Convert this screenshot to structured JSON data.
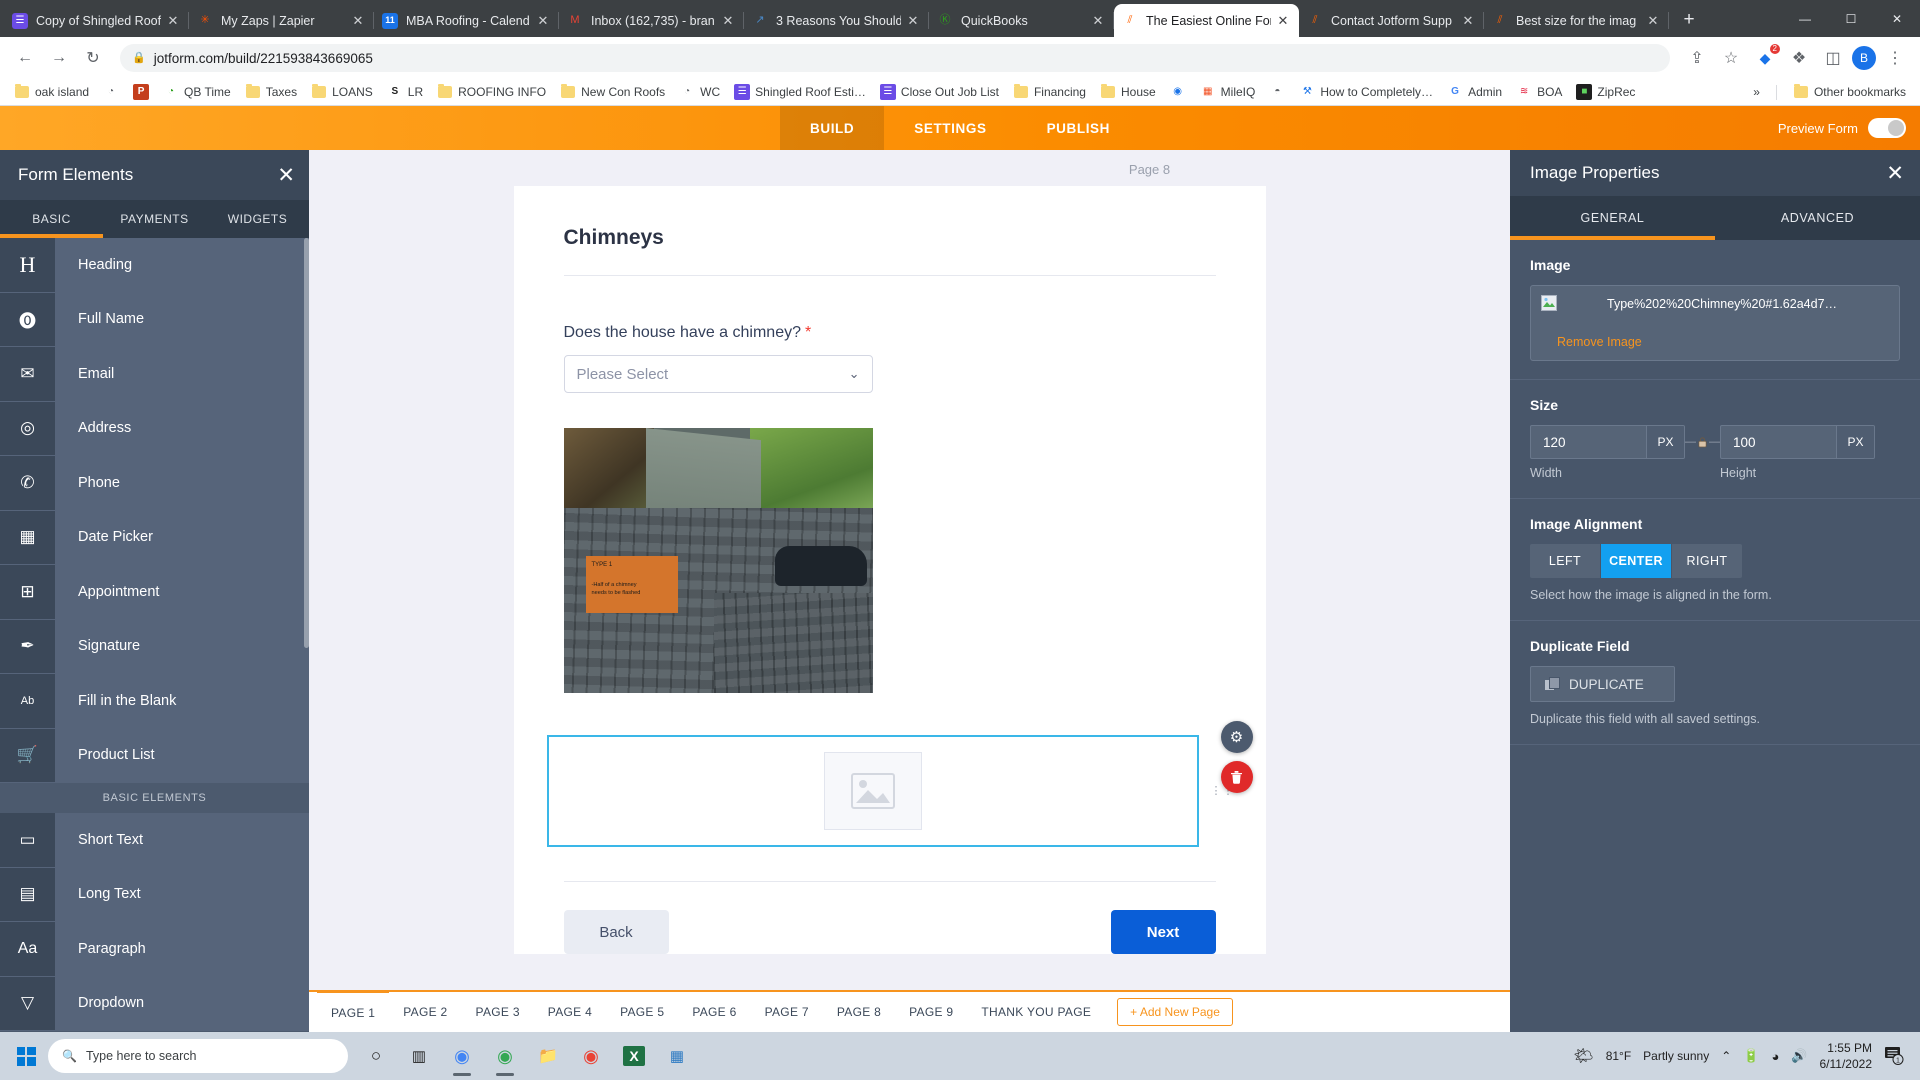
{
  "browser": {
    "tabs": [
      {
        "title": "Copy of Shingled Roof",
        "favicon": "list-icon",
        "fav_color": "#6b4ce6",
        "fav_glyph": "☰",
        "active": false
      },
      {
        "title": "My Zaps | Zapier",
        "favicon": "zapier-icon",
        "fav_color": "#ff4f00",
        "fav_glyph": "✳",
        "active": false
      },
      {
        "title": "MBA Roofing - Calend",
        "favicon": "google-calendar-icon",
        "fav_color": "#1a73e8",
        "fav_glyph": "11",
        "active": false
      },
      {
        "title": "Inbox (162,735) - bran",
        "favicon": "gmail-icon",
        "fav_color": "#ea4335",
        "fav_glyph": "M",
        "active": false
      },
      {
        "title": "3 Reasons You Should",
        "favicon": "chart-icon",
        "fav_color": "#4a88c7",
        "fav_glyph": "↗",
        "active": false
      },
      {
        "title": "QuickBooks",
        "favicon": "quickbooks-icon",
        "fav_color": "#2ca01c",
        "fav_glyph": "Ⓚ",
        "active": false
      },
      {
        "title": "The Easiest Online For",
        "favicon": "jotform-icon",
        "fav_color": "#ff6100",
        "fav_glyph": "⫽",
        "active": true
      },
      {
        "title": "Contact Jotform Supp",
        "favicon": "jotform-icon",
        "fav_color": "#ff6100",
        "fav_glyph": "⫽",
        "active": false
      },
      {
        "title": "Best size for the imag",
        "favicon": "jotform-icon",
        "fav_color": "#ff6100",
        "fav_glyph": "⫽",
        "active": false
      }
    ],
    "tab_close_label": "✕",
    "new_tab_label": "+",
    "window_controls": {
      "minimize": "—",
      "maximize": "☐",
      "close": "✕"
    },
    "nav": {
      "back": "←",
      "forward": "→",
      "reload": "↻"
    },
    "omnibox": {
      "lock": "🔒",
      "url": "jotform.com/build/221593843669065"
    },
    "toolbar_icons": {
      "share": "⇪",
      "bookmark_star": "☆",
      "extension_count": "2",
      "puzzle": "❖",
      "sidepanel": "◫",
      "profile_initial": "B",
      "menu": "⋮"
    },
    "bookmarks": [
      {
        "label": "oak island",
        "icon": "folder-icon"
      },
      {
        "label": "",
        "icon": "globe-icon"
      },
      {
        "label": "",
        "icon": "powerpoint-icon"
      },
      {
        "label": "QB Time",
        "icon": "qbtime-icon"
      },
      {
        "label": "Taxes",
        "icon": "folder-icon"
      },
      {
        "label": "LOANS",
        "icon": "folder-icon"
      },
      {
        "label": "LR",
        "icon": "stripe-icon"
      },
      {
        "label": "ROOFING INFO",
        "icon": "folder-icon"
      },
      {
        "label": "New Con Roofs",
        "icon": "folder-icon"
      },
      {
        "label": "WC",
        "icon": "globe-icon"
      },
      {
        "label": "Shingled Roof Esti…",
        "icon": "list-icon"
      },
      {
        "label": "Close Out Job List",
        "icon": "list-icon"
      },
      {
        "label": "Financing",
        "icon": "folder-icon"
      },
      {
        "label": "House",
        "icon": "folder-icon"
      },
      {
        "label": "",
        "icon": "maps-pin-icon"
      },
      {
        "label": "MileIQ",
        "icon": "mileiq-icon"
      },
      {
        "label": "",
        "icon": "owl-icon"
      },
      {
        "label": "How to Completely…",
        "icon": "tool-icon"
      },
      {
        "label": "Admin",
        "icon": "google-icon"
      },
      {
        "label": "BOA",
        "icon": "bankofamerica-icon"
      },
      {
        "label": "ZipRec",
        "icon": "ziprecruiter-icon"
      }
    ],
    "bookmarks_overflow": "»",
    "other_bookmarks": {
      "label": "Other bookmarks",
      "icon": "folder-icon"
    }
  },
  "jotform": {
    "header": {
      "tabs": [
        {
          "label": "BUILD",
          "active": true
        },
        {
          "label": "SETTINGS",
          "active": false
        },
        {
          "label": "PUBLISH",
          "active": false
        }
      ],
      "preview_label": "Preview Form",
      "preview_toggle_on": false
    },
    "left_panel": {
      "title": "Form Elements",
      "close_icon": "✕",
      "tabs": [
        {
          "label": "BASIC",
          "active": true
        },
        {
          "label": "PAYMENTS",
          "active": false
        },
        {
          "label": "WIDGETS",
          "active": false
        }
      ],
      "items": [
        {
          "label": "Heading",
          "icon": "heading-icon",
          "glyph": "H",
          "type": "item"
        },
        {
          "label": "Full Name",
          "icon": "user-icon",
          "glyph": "⓿",
          "type": "item"
        },
        {
          "label": "Email",
          "icon": "envelope-icon",
          "glyph": "✉",
          "type": "item"
        },
        {
          "label": "Address",
          "icon": "map-pin-icon",
          "glyph": "◎",
          "type": "item"
        },
        {
          "label": "Phone",
          "icon": "phone-icon",
          "glyph": "✆",
          "type": "item"
        },
        {
          "label": "Date Picker",
          "icon": "calendar-icon",
          "glyph": "▦",
          "type": "item"
        },
        {
          "label": "Appointment",
          "icon": "appointment-icon",
          "glyph": "⊞",
          "type": "item"
        },
        {
          "label": "Signature",
          "icon": "pen-icon",
          "glyph": "✒",
          "type": "item"
        },
        {
          "label": "Fill in the Blank",
          "icon": "fill-blank-icon",
          "glyph": "Ab",
          "type": "item"
        },
        {
          "label": "Product List",
          "icon": "cart-icon",
          "glyph": "🛒",
          "type": "item"
        },
        {
          "label": "BASIC ELEMENTS",
          "type": "group"
        },
        {
          "label": "Short Text",
          "icon": "short-text-icon",
          "glyph": "▭",
          "type": "item"
        },
        {
          "label": "Long Text",
          "icon": "long-text-icon",
          "glyph": "▤",
          "type": "item"
        },
        {
          "label": "Paragraph",
          "icon": "paragraph-icon",
          "glyph": "Aa",
          "type": "item"
        },
        {
          "label": "Dropdown",
          "icon": "dropdown-icon",
          "glyph": "▽",
          "type": "item"
        }
      ]
    },
    "canvas": {
      "page_label": "Page 8",
      "form_title": "Chimneys",
      "question_label": "Does the house have a chimney?",
      "required_marker": "*",
      "select_placeholder": "Please Select",
      "select_chevron": "⌄",
      "photo_note": {
        "line1": "TYPE 1",
        "line2": "-Half of a chimney",
        "line3": "needs to be flashed"
      },
      "image_field": {
        "placeholder_icon": "image-placeholder-icon",
        "gear_icon": "⚙",
        "trash_icon": "🗑",
        "drag_handle": "⋮⋮"
      },
      "back_label": "Back",
      "next_label": "Next",
      "pages": [
        {
          "label": "PAGE 1",
          "active": true
        },
        {
          "label": "PAGE 2",
          "active": false
        },
        {
          "label": "PAGE 3",
          "active": false
        },
        {
          "label": "PAGE 4",
          "active": false
        },
        {
          "label": "PAGE 5",
          "active": false
        },
        {
          "label": "PAGE 6",
          "active": false
        },
        {
          "label": "PAGE 7",
          "active": false
        },
        {
          "label": "PAGE 8",
          "active": false
        },
        {
          "label": "PAGE 9",
          "active": false
        },
        {
          "label": "THANK YOU PAGE",
          "active": false
        }
      ],
      "add_page_label": "+ Add New Page"
    },
    "right_panel": {
      "title": "Image Properties",
      "close_icon": "✕",
      "tabs": [
        {
          "label": "GENERAL",
          "active": true
        },
        {
          "label": "ADVANCED",
          "active": false
        }
      ],
      "image_section": {
        "title": "Image",
        "filename": "Type%202%20Chimney%20#1.62a4d7…",
        "remove_label": "Remove Image"
      },
      "size_section": {
        "title": "Size",
        "width_value": "120",
        "width_unit": "PX",
        "width_caption": "Width",
        "height_value": "100",
        "height_unit": "PX",
        "height_caption": "Height",
        "lock_icon": "🔒"
      },
      "alignment_section": {
        "title": "Image Alignment",
        "options": [
          {
            "label": "LEFT",
            "active": false
          },
          {
            "label": "CENTER",
            "active": true
          },
          {
            "label": "RIGHT",
            "active": false
          }
        ],
        "hint": "Select how the image is aligned in the form."
      },
      "duplicate_section": {
        "title": "Duplicate Field",
        "button_label": "DUPLICATE",
        "hint": "Duplicate this field with all saved settings."
      }
    }
  },
  "taskbar": {
    "search_placeholder": "Type here to search",
    "search_icon": "🔍",
    "apps": [
      {
        "name": "cortana-icon",
        "glyph": "○"
      },
      {
        "name": "task-view-icon",
        "glyph": "▥"
      },
      {
        "name": "chrome-icon",
        "glyph": "◉"
      },
      {
        "name": "chrome-active-icon",
        "glyph": "◉"
      },
      {
        "name": "file-explorer-icon",
        "glyph": "📁"
      },
      {
        "name": "chrome-icon-2",
        "glyph": "◉"
      },
      {
        "name": "excel-icon",
        "glyph": "X"
      },
      {
        "name": "calculator-icon",
        "glyph": "▦"
      }
    ],
    "weather": {
      "temp": "81°F",
      "desc": "Partly sunny"
    },
    "tray": {
      "chevron": "⌃",
      "battery": "🔋",
      "wifi": "◠",
      "volume": "🔊"
    },
    "clock": {
      "time": "1:55 PM",
      "date": "6/11/2022"
    },
    "notification_count": "1"
  },
  "colors": {
    "jotform_orange": "#f7941e",
    "panel_dark": "#3b4859",
    "panel_mid": "#4c5a6e",
    "accent_blue": "#13a0f0",
    "next_blue": "#0a5ed7",
    "danger_red": "#e02a2a"
  }
}
